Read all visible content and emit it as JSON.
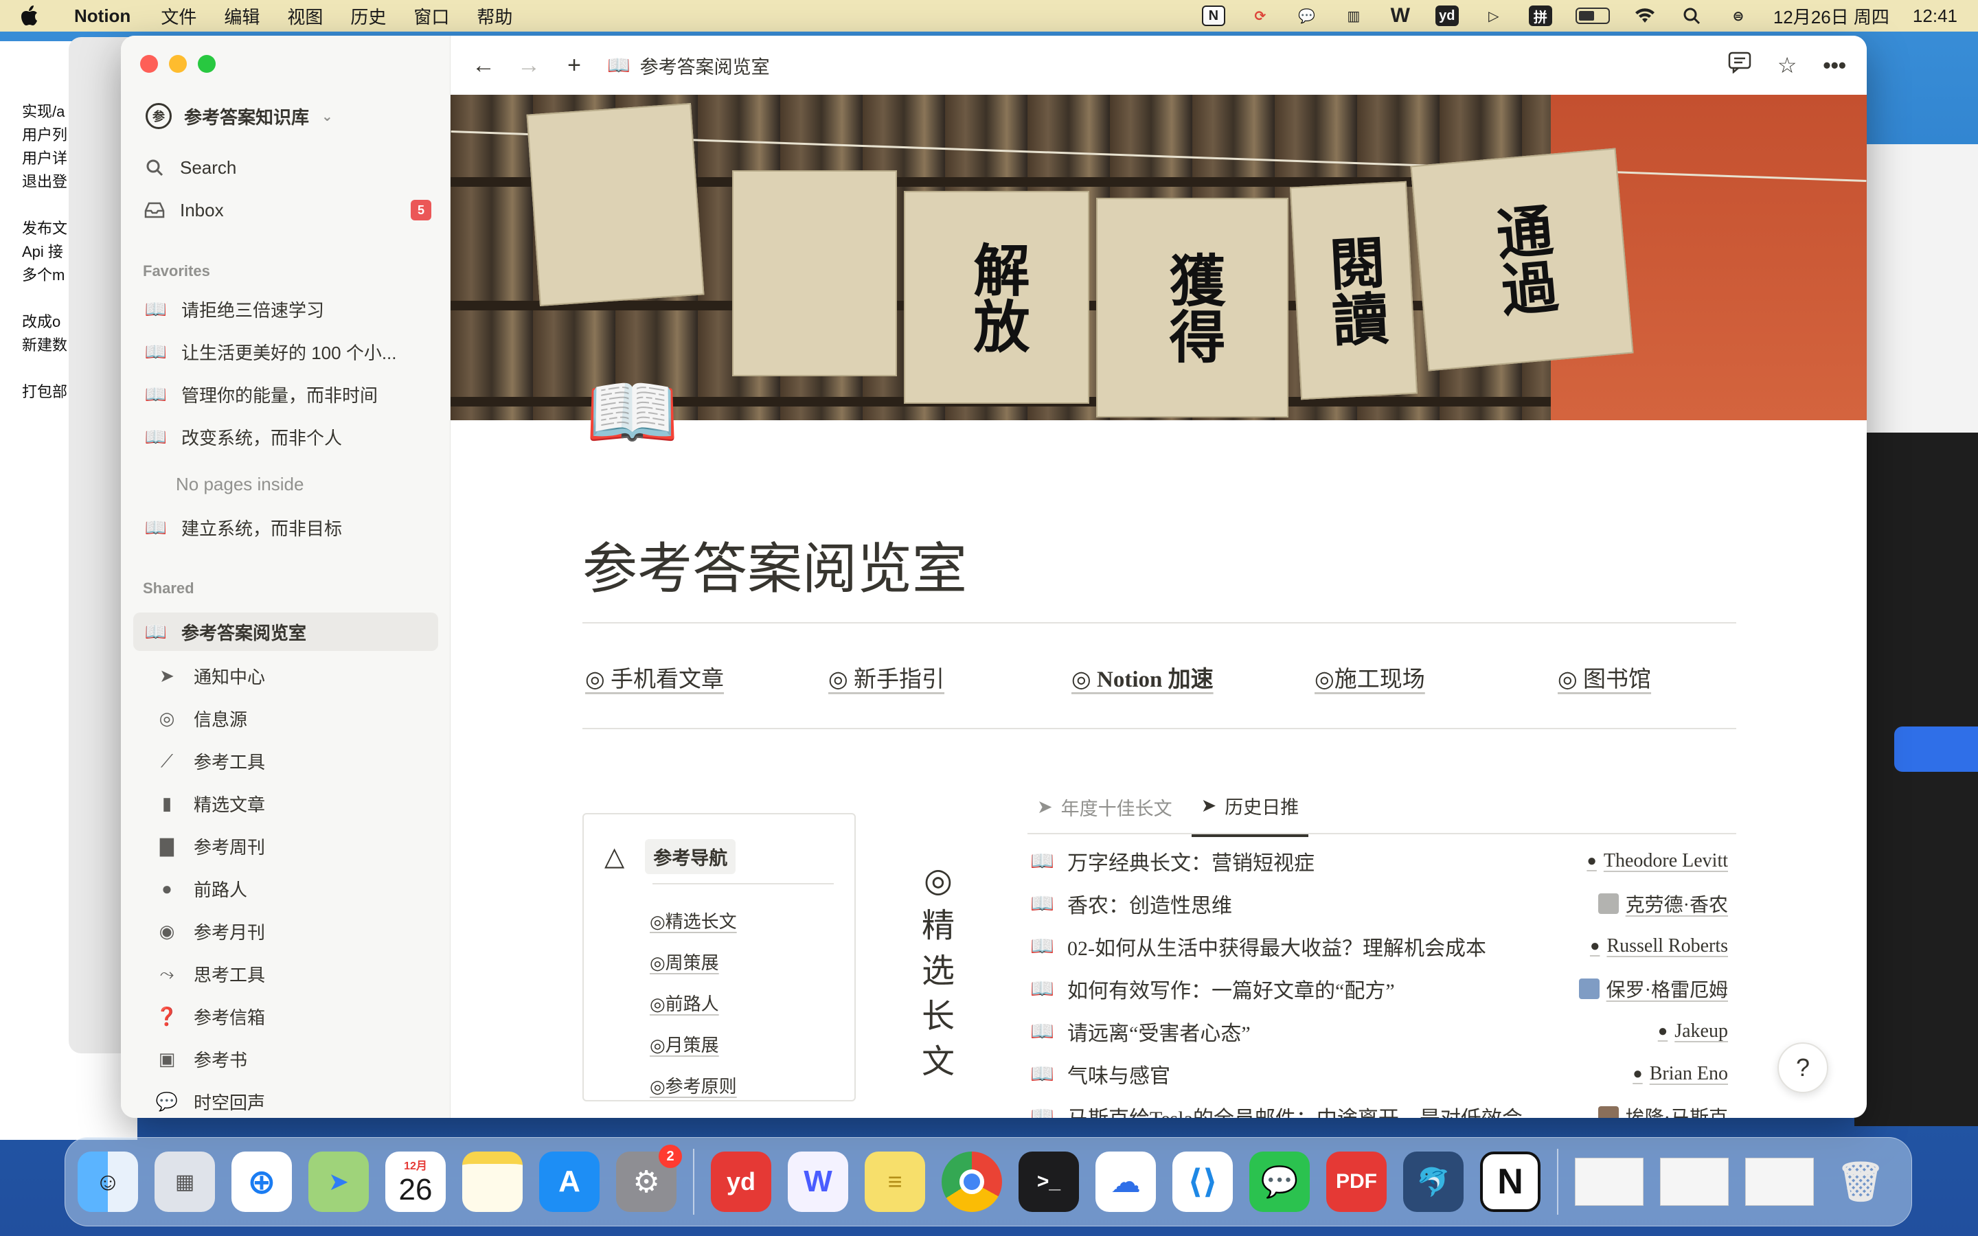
{
  "menubar": {
    "app_name": "Notion",
    "menus": [
      "文件",
      "编辑",
      "视图",
      "历史",
      "窗口",
      "帮助"
    ],
    "datetime": "12月26日 周四",
    "time": "12:41",
    "tray": [
      "notion-tray",
      "sync",
      "wechat",
      "stats",
      "W",
      "yd",
      "play",
      "拼"
    ]
  },
  "background": {
    "left_lines": [
      "实现/a",
      "",
      "用户列",
      "用户详",
      "退出登",
      "",
      "发布文",
      "Api 接",
      "多个m",
      "",
      "改成o",
      "新建数",
      "",
      "打包部"
    ]
  },
  "sidebar": {
    "workspace": "参考答案知识库",
    "workspace_icon": "参",
    "search": "Search",
    "inbox": "Inbox",
    "inbox_count": "5",
    "favorites_label": "Favorites",
    "favorites": [
      "请拒绝三倍速学习",
      "让生活更美好的 100 个小...",
      "管理你的能量，而非时间",
      "改变系统，而非个人",
      "建立系统，而非目标"
    ],
    "no_pages": "No pages inside",
    "shared_label": "Shared",
    "shared_page": "参考答案阅览室",
    "children": [
      "通知中心",
      "信息源",
      "参考工具",
      "精选文章",
      "参考周刊",
      "前路人",
      "参考月刊",
      "思考工具",
      "参考信箱",
      "参考书",
      "时空回声"
    ]
  },
  "topbar": {
    "breadcrumb": "参考答案阅览室"
  },
  "cover": {
    "bags": [
      "解放",
      "獲得",
      "閱讀",
      "通過"
    ]
  },
  "page": {
    "icon": "📖",
    "title": "参考答案阅览室",
    "quick_links": [
      "◎ 手机看文章",
      "◎ 新手指引",
      "◎ Notion 加速",
      "◎施工现场",
      "◎ 图书馆"
    ],
    "nav_card": {
      "title": "参考导航",
      "links": [
        "◎精选长文",
        "◎周策展",
        "◎前路人",
        "◎月策展",
        "◎参考原则"
      ]
    },
    "vertical_title": "◎精选长文",
    "tabs": [
      "年度十佳长文",
      "历史日推"
    ],
    "articles": [
      {
        "title": "万字经典长文：营销短视症",
        "author": "Theodore Levitt"
      },
      {
        "title": "香农：创造性思维",
        "author": "克劳德·香农"
      },
      {
        "title": "02-如何从生活中获得最大收益？理解机会成本",
        "author": "Russell Roberts"
      },
      {
        "title": "如何有效写作：一篇好文章的“配方”",
        "author": "保罗·格雷厄姆"
      },
      {
        "title": "请远离“受害者心态”",
        "author": "Jakeup"
      },
      {
        "title": "气味与感官",
        "author": "Brian Eno"
      },
      {
        "title": "马斯克给Tesla的全员邮件：中途离开，是对低效会",
        "author": "埃隆·马斯克"
      }
    ],
    "help": "?"
  },
  "dock": {
    "calendar_month": "12月",
    "calendar_day": "26",
    "settings_badge": "2"
  }
}
